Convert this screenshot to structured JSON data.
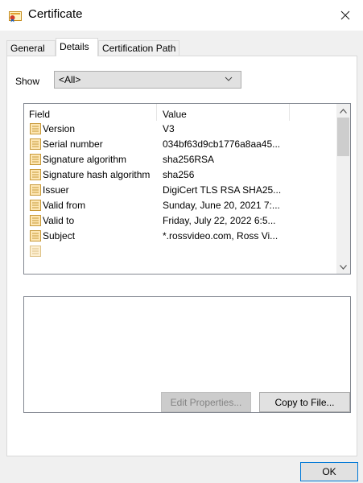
{
  "window": {
    "title": "Certificate"
  },
  "tabs": [
    {
      "label": "General",
      "active": false
    },
    {
      "label": "Details",
      "active": true
    },
    {
      "label": "Certification Path",
      "active": false
    }
  ],
  "show": {
    "label": "Show",
    "selected": "<All>"
  },
  "list": {
    "columns": [
      "Field",
      "Value"
    ],
    "rows": [
      {
        "field": "Version",
        "value": "V3"
      },
      {
        "field": "Serial number",
        "value": "034bf63d9cb1776a8aa45..."
      },
      {
        "field": "Signature algorithm",
        "value": "sha256RSA"
      },
      {
        "field": "Signature hash algorithm",
        "value": "sha256"
      },
      {
        "field": "Issuer",
        "value": "DigiCert TLS RSA SHA25..."
      },
      {
        "field": "Valid from",
        "value": "Sunday, June 20, 2021 7:..."
      },
      {
        "field": "Valid to",
        "value": "Friday, July 22, 2022 6:5..."
      },
      {
        "field": "Subject",
        "value": "*.rossvideo.com, Ross Vi..."
      }
    ],
    "row_icon": "certificate-field-icon"
  },
  "buttons": {
    "edit_properties": "Edit Properties...",
    "copy_to_file": "Copy to File...",
    "ok": "OK"
  },
  "colors": {
    "dialog_bg": "#f0f0f0",
    "accent": "#0078d7",
    "disabled_text": "#838383"
  }
}
